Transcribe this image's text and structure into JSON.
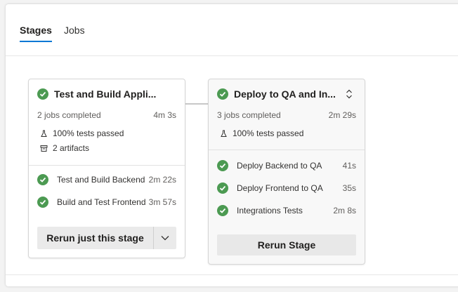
{
  "tabs": [
    {
      "label": "Stages",
      "active": true
    },
    {
      "label": "Jobs",
      "active": false
    }
  ],
  "colors": {
    "accent": "#0078d4",
    "success": "#4c9a52"
  },
  "stages": [
    {
      "title": "Test and Build Appli...",
      "status_icon": "success-check-icon",
      "jobs_summary": "2 jobs completed",
      "duration": "4m 3s",
      "tests": "100% tests passed",
      "artifacts": "2 artifacts",
      "jobs": [
        {
          "name": "Test and Build Backend",
          "time": "2m 22s"
        },
        {
          "name": "Build and Test Frontend",
          "time": "3m 57s"
        }
      ],
      "rerun_label": "Rerun just this stage"
    },
    {
      "title": "Deploy to QA and In...",
      "status_icon": "success-check-icon",
      "jobs_summary": "3 jobs completed",
      "duration": "2m 29s",
      "tests": "100% tests passed",
      "jobs": [
        {
          "name": "Deploy Backend to QA",
          "time": "41s"
        },
        {
          "name": "Deploy Frontend to QA",
          "time": "35s"
        },
        {
          "name": "Integrations Tests",
          "time": "2m 8s"
        }
      ],
      "rerun_label": "Rerun Stage"
    }
  ]
}
